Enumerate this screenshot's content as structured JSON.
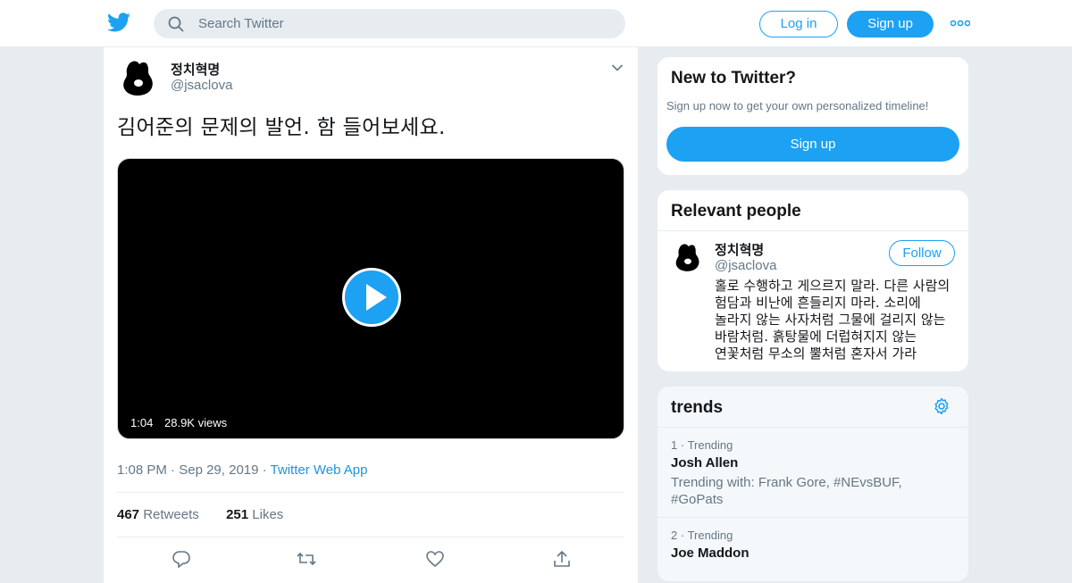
{
  "header": {
    "search_placeholder": "Search Twitter",
    "login_label": "Log in",
    "signup_label": "Sign up"
  },
  "tweet": {
    "author_name": "정치혁명",
    "author_handle": "@jsaclova",
    "text": "김어준의 문제의 발언. 함 들어보세요.",
    "video": {
      "duration": "1:04",
      "views": "28.9K views"
    },
    "time": "1:08 PM",
    "date": "Sep 29, 2019",
    "source": "Twitter Web App",
    "retweets_count": "467",
    "retweets_label": "Retweets",
    "likes_count": "251",
    "likes_label": "Likes"
  },
  "new_to_twitter": {
    "title": "New to Twitter?",
    "subtitle": "Sign up now to get your own personalized timeline!",
    "button": "Sign up"
  },
  "relevant_people": {
    "title": "Relevant people",
    "name": "정치혁명",
    "handle": "@jsaclova",
    "follow_label": "Follow",
    "bio": "홀로 수행하고 게으르지 말라. 다른 사람의 험담과 비난에 흔들리지 마라. 소리에 놀라지 않는 사자처럼 그물에 걸리지 않는 바람처럼. 흙탕물에 더럽혀지지 않는 연꽃처럼 무소의 뿔처럼 혼자서 가라"
  },
  "trends": {
    "title": "trends",
    "items": [
      {
        "rank": "1",
        "label": "Trending",
        "name": "Josh Allen",
        "desc": "Trending with: Frank Gore, #NEvsBUF, #GoPats"
      },
      {
        "rank": "2",
        "label": "Trending",
        "name": "Joe Maddon",
        "desc": ""
      }
    ]
  },
  "colors": {
    "accent": "#1da1f2",
    "text": "#14171a",
    "muted": "#657786",
    "bg": "#e6ecf0"
  }
}
